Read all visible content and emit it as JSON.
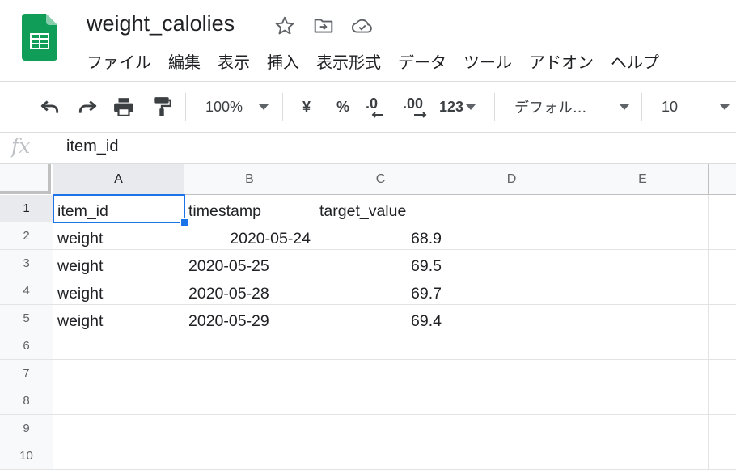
{
  "document": {
    "title": "weight_calolies"
  },
  "menu": [
    "ファイル",
    "編集",
    "表示",
    "挿入",
    "表示形式",
    "データ",
    "ツール",
    "アドオン",
    "ヘルプ"
  ],
  "toolbar": {
    "zoom": "100%",
    "currency": "¥",
    "percent": "%",
    "decrease_decimal": ".0",
    "increase_decimal": ".00",
    "number_format": "123",
    "font": "デフォル...",
    "font_size": "10"
  },
  "formula_bar": {
    "fx": "fx",
    "value": "item_id"
  },
  "sheet": {
    "columns": [
      "A",
      "B",
      "C",
      "D",
      "E"
    ],
    "row_numbers": [
      "1",
      "2",
      "3",
      "4",
      "5",
      "6",
      "7",
      "8",
      "9",
      "10"
    ],
    "rows": [
      [
        "item_id",
        "timestamp",
        "target_value",
        "",
        ""
      ],
      [
        "weight",
        "2020-05-24",
        "68.9",
        "",
        ""
      ],
      [
        "weight",
        "2020-05-25",
        "69.5",
        "",
        ""
      ],
      [
        "weight",
        "2020-05-28",
        "69.7",
        "",
        ""
      ],
      [
        "weight",
        "2020-05-29",
        "69.4",
        "",
        ""
      ],
      [
        "",
        "",
        "",
        "",
        ""
      ],
      [
        "",
        "",
        "",
        "",
        ""
      ],
      [
        "",
        "",
        "",
        "",
        ""
      ],
      [
        "",
        "",
        "",
        "",
        ""
      ],
      [
        "",
        "",
        "",
        "",
        ""
      ]
    ],
    "right_aligned": [
      [
        1,
        1
      ],
      [
        1,
        2
      ],
      [
        2,
        2
      ],
      [
        3,
        2
      ],
      [
        4,
        2
      ]
    ],
    "active_cell": "A1"
  },
  "colors": {
    "accent": "#1a73e8",
    "sheets_green": "#0f9d58",
    "grid_line": "#e2e3e3"
  }
}
